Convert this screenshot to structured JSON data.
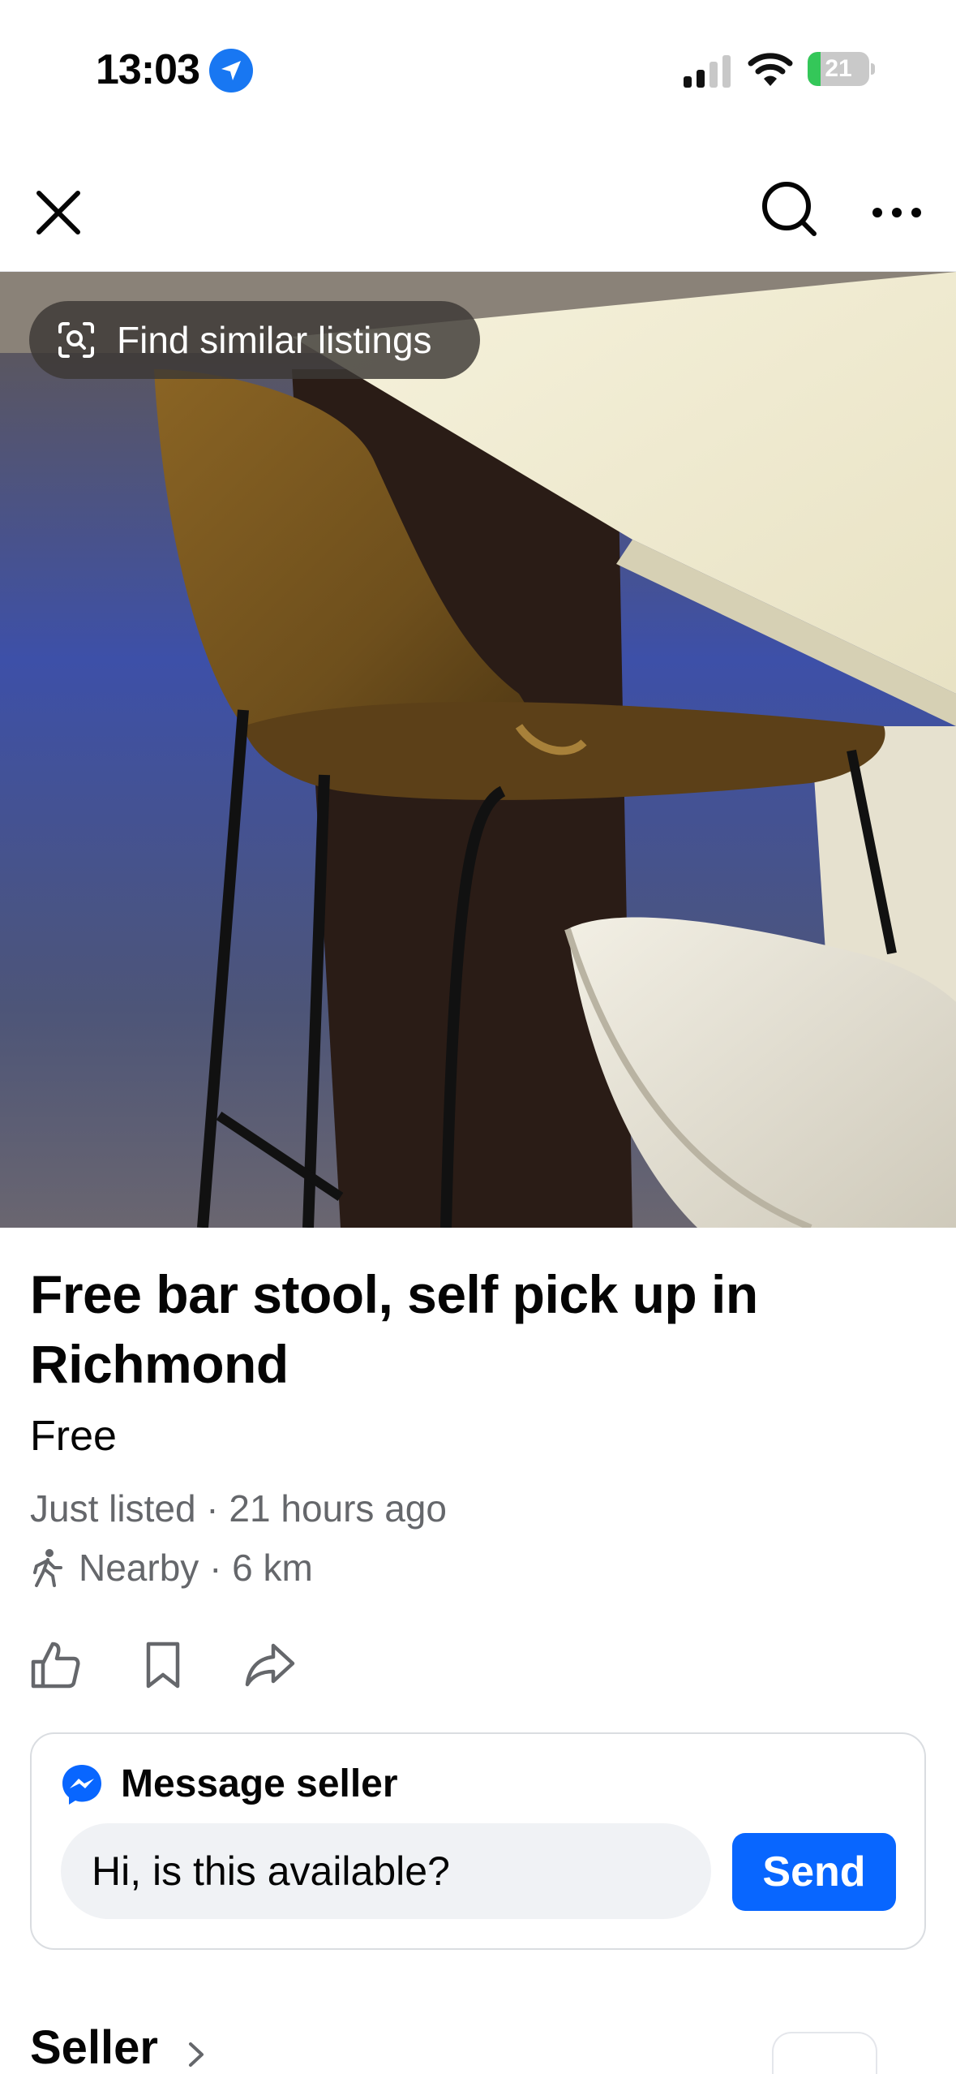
{
  "status_bar": {
    "time": "13:03",
    "battery_level": "21",
    "battery_fraction": 0.21,
    "battery_color": "#34c759"
  },
  "nav": {
    "close_icon": "close-icon",
    "search_icon": "search-icon",
    "more_icon": "more-horizontal-icon"
  },
  "photo": {
    "description_icon": "visual-search-icon",
    "find_similar_label": "Find similar listings"
  },
  "listing": {
    "title": "Free bar stool, self pick up in Richmond",
    "price": "Free",
    "listed_time": "Just listed · 21 hours ago",
    "location": "Nearby · 6 km"
  },
  "actions": {
    "like_icon": "thumbs-up-icon",
    "save_icon": "bookmark-icon",
    "share_icon": "share-icon"
  },
  "message": {
    "heading": "Message seller",
    "input_value": "Hi, is this available?",
    "send_label": "Send",
    "accent_color": "#0866ff"
  },
  "seller": {
    "heading": "Seller"
  }
}
